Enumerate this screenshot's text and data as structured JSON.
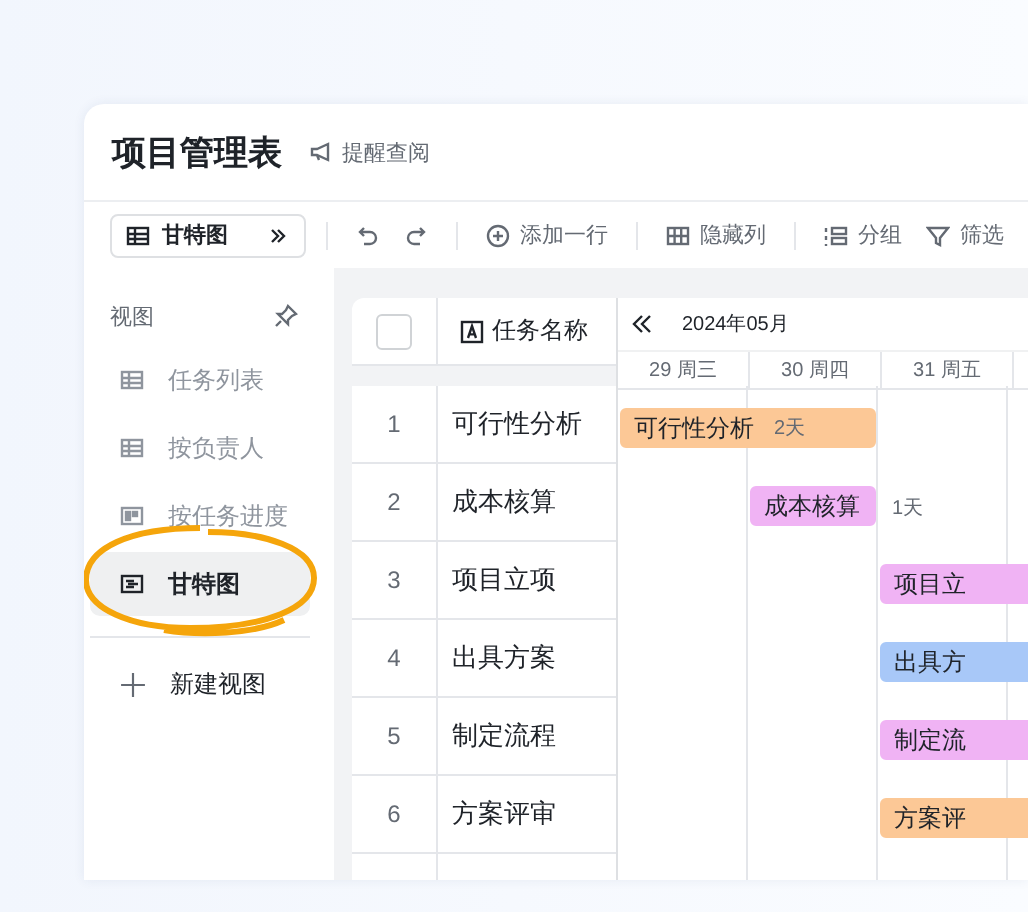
{
  "header": {
    "title": "项目管理表",
    "remind": "提醒查阅"
  },
  "toolbar": {
    "view_switch": "甘特图",
    "buttons": [
      {
        "kind": "add",
        "label": "添加一行"
      },
      {
        "kind": "hide",
        "label": "隐藏列"
      },
      {
        "kind": "group",
        "label": "分组"
      },
      {
        "kind": "filter",
        "label": "筛选"
      }
    ]
  },
  "sidebar": {
    "title": "视图",
    "items": [
      {
        "kind": "table",
        "label": "任务列表",
        "selected": false
      },
      {
        "kind": "table",
        "label": "按负责人",
        "selected": false
      },
      {
        "kind": "kanban",
        "label": "按任务进度",
        "selected": false
      },
      {
        "kind": "gantt",
        "label": "甘特图",
        "selected": true
      }
    ],
    "new_view": "新建视图"
  },
  "table": {
    "select_all": {
      "checked": false
    },
    "columns": [
      {
        "label": "任务名称"
      }
    ],
    "rows": [
      {
        "index": "1",
        "name": "可行性分析"
      },
      {
        "index": "2",
        "name": "成本核算"
      },
      {
        "index": "3",
        "name": "项目立项"
      },
      {
        "index": "4",
        "name": "出具方案"
      },
      {
        "index": "5",
        "name": "制定流程"
      },
      {
        "index": "6",
        "name": "方案评审"
      }
    ]
  },
  "gantt": {
    "month": "2024年05月",
    "days": [
      "29 周三",
      "30 周四",
      "31 周五"
    ],
    "bars": [
      {
        "kind": "early",
        "label": "可行性分析",
        "duration": "2天",
        "color": "#fcc896"
      },
      {
        "kind": "middle",
        "label": "成本核算",
        "duration": "1天",
        "color": "#f0b3f4"
      },
      {
        "kind": "late",
        "label": "项目立",
        "color": "#f0b3f4"
      },
      {
        "kind": "late",
        "label": "出具方",
        "color": "#a8c8f8"
      },
      {
        "kind": "late",
        "label": "制定流",
        "color": "#f0b3f4"
      },
      {
        "kind": "late",
        "label": "方案评",
        "color": "#fcc896"
      }
    ]
  }
}
